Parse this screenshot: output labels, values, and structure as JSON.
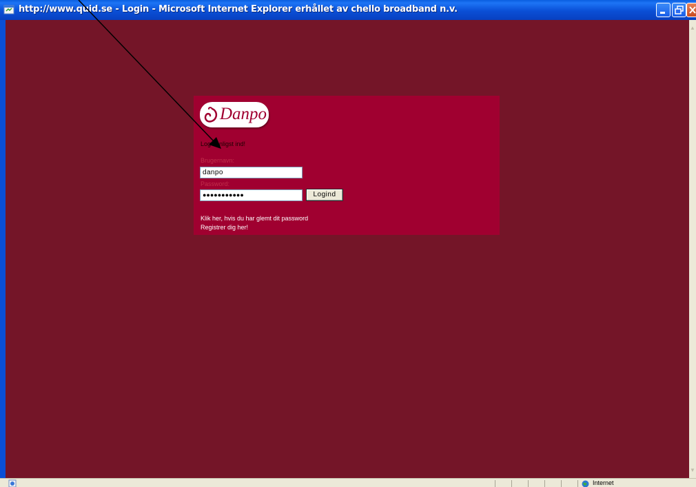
{
  "window": {
    "title": "http://www.quid.se - Login - Microsoft Internet Explorer erhållet av chello broadband n.v.",
    "controls": [
      "minimize-icon",
      "maximize-icon",
      "close-icon"
    ]
  },
  "page": {
    "background": "#741528",
    "panel_color": "#a00030",
    "logo_text": "Danpo",
    "welcome_text": "Log venligst ind!",
    "username_label": "Brugernavn:",
    "username_value": "danpo",
    "password_label": "Password:",
    "password_value": "●●●●●●●●●●●",
    "login_button": "Logind",
    "forgot_link": "Klik her, hvis du har glemt dit password",
    "register_link": "Registrer dig her!"
  },
  "statusbar": {
    "zone_text": "Internet",
    "icon": "ie-page-icon"
  }
}
